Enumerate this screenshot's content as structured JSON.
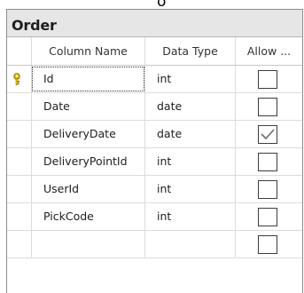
{
  "top_glyph": "δ",
  "table": {
    "title": "Order",
    "columns": {
      "name": "Column Name",
      "type": "Data Type",
      "allow": "Allow ..."
    },
    "rows": [
      {
        "name": "Id",
        "type": "int",
        "allow_nulls": false,
        "primary_key": true
      },
      {
        "name": "Date",
        "type": "date",
        "allow_nulls": false,
        "primary_key": false
      },
      {
        "name": "DeliveryDate",
        "type": "date",
        "allow_nulls": true,
        "primary_key": false
      },
      {
        "name": "DeliveryPointId",
        "type": "int",
        "allow_nulls": false,
        "primary_key": false
      },
      {
        "name": "UserId",
        "type": "int",
        "allow_nulls": false,
        "primary_key": false
      },
      {
        "name": "PickCode",
        "type": "int",
        "allow_nulls": false,
        "primary_key": false
      },
      {
        "name": "",
        "type": "",
        "allow_nulls": false,
        "primary_key": false
      }
    ]
  },
  "icons": {
    "primary_key": "key-icon",
    "checked": "check-icon"
  },
  "colors": {
    "title_bar": "#e6e6e6",
    "key": "#c8a800",
    "check": "#6b6b6b"
  }
}
